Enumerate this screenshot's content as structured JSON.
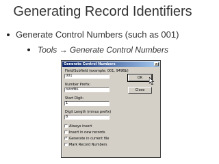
{
  "slide": {
    "title": "Generating Record Identifiers",
    "bullets": [
      "Generate Control Numbers (such as 001)",
      "Tools → Generate Control Numbers"
    ]
  },
  "dialog": {
    "title": "Generate Control Numbers",
    "close_glyph": "x",
    "field_subfield_label": "Field/Subfield (example: 001, 949Bb)",
    "field_subfield_value": "001",
    "number_prefix_label": "Number Prefix:",
    "number_prefix_value": "tutofBK",
    "start_digit_label": "Start Digit:",
    "start_digit_value": "1",
    "digit_length_label": "Digit Length (minus prefix)",
    "digit_length_value": "8",
    "ok_label": "OK",
    "close_label": "Close",
    "checkboxes": [
      {
        "label": "Always insert",
        "checked": false
      },
      {
        "label": "Insert in new records",
        "checked": false
      },
      {
        "label": "Generate in current file",
        "checked": true
      },
      {
        "label": "Mark Record Numbers",
        "checked": false
      }
    ],
    "check_glyph": "✓"
  },
  "colors": {
    "dialog_face": "#d4d0c8",
    "titlebar_start": "#0a246a",
    "titlebar_end": "#a6caf0",
    "slide_text": "#333333"
  }
}
